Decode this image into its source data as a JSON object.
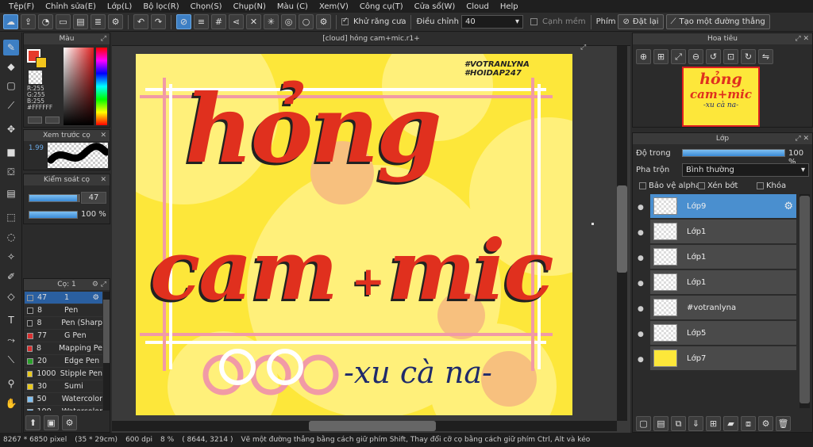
{
  "menu": [
    "Tệp(F)",
    "Chỉnh sửa(E)",
    "Lớp(L)",
    "Bộ lọc(R)",
    "Chọn(S)",
    "Chụp(N)",
    "Màu (C)",
    "Xem(V)",
    "Công cụ(T)",
    "Cửa sổ(W)",
    "Cloud",
    "Help"
  ],
  "toolbar": {
    "antialias_label": "Khử răng cưa",
    "adjust_label": "Điều chỉnh",
    "adjust_value": "40",
    "edge_label": "Cạnh mềm",
    "key_label": "Phím",
    "reset_label": "Đặt lại",
    "make_line_label": "Tạo một đường thẳng"
  },
  "color_panel": {
    "title": "Màu",
    "r": "R:255",
    "g": "G:255",
    "b": "B:255",
    "hex": "#FFFFFF"
  },
  "preview_panel": {
    "title": "Xem trước cọ",
    "size": "1.99"
  },
  "brush_control": {
    "title": "Kiểm soát cọ",
    "size": "47",
    "opacity": "100 %"
  },
  "brush_panel": {
    "title": "Cọ: 1",
    "brushes": [
      {
        "size": "47",
        "name": "1",
        "color": "#2a5fa0",
        "selected": true
      },
      {
        "size": "8",
        "name": "Pen",
        "color": "#222222"
      },
      {
        "size": "8",
        "name": "Pen (Sharp",
        "color": "#222222"
      },
      {
        "size": "77",
        "name": "G Pen",
        "color": "#d93030"
      },
      {
        "size": "8",
        "name": "Mapping Pe",
        "color": "#d93030"
      },
      {
        "size": "20",
        "name": "Edge Pen",
        "color": "#2aa02a"
      },
      {
        "size": "1000",
        "name": "Stipple Pen",
        "color": "#e8c81c"
      },
      {
        "size": "30",
        "name": "Sumi",
        "color": "#e8c81c"
      },
      {
        "size": "50",
        "name": "Watercolor",
        "color": "#7fc0f2"
      },
      {
        "size": "100",
        "name": "Watercolor",
        "color": "#7fc0f2"
      }
    ]
  },
  "document": {
    "tab_title": "[cloud] hỏng cam+mic.r1+",
    "hashtag1": "#VOTRANLYNA",
    "hashtag2": "#HOIDAP247",
    "word1": "hỏng",
    "word2": "cam",
    "plus": "+",
    "word3": "mic",
    "subtitle": "-xu cà na-"
  },
  "navigator": {
    "title": "Hoa tiêu",
    "thumb_line1": "hỏng",
    "thumb_line2": "cam+mic",
    "thumb_line3": "-xu cà na-"
  },
  "layer_panel": {
    "title": "Lớp",
    "opacity_label": "Độ trong",
    "opacity_value": "100 %",
    "blend_label": "Pha trộn",
    "blend_value": "Bình thường",
    "protect_alpha": "Bảo vệ alpha",
    "clipping": "Xén bớt",
    "lock": "Khóa",
    "layers": [
      {
        "name": "Lớp9",
        "selected": true
      },
      {
        "name": "Lớp1"
      },
      {
        "name": "Lớp1"
      },
      {
        "name": "Lớp1"
      },
      {
        "name": "#votranlyna"
      },
      {
        "name": "Lớp5"
      },
      {
        "name": "Lớp7"
      }
    ]
  },
  "status": {
    "size": "8267 * 6850 pixel",
    "cm": "(35 * 29cm)",
    "dpi": "600 dpi",
    "zoom": "8 %",
    "coords": "( 8644, 3214 )",
    "hint": "Vẽ một đường thẳng bằng cách giữ phím Shift, Thay đổi cỡ cọ bằng cách giữ phím Ctrl, Alt và kéo"
  },
  "colors": {
    "accent": "#3d7fc4",
    "canvas_yellow": "#fde73a",
    "letter_red": "#e0301e",
    "pink": "#f19aa6",
    "navy": "#1f2a6b"
  }
}
